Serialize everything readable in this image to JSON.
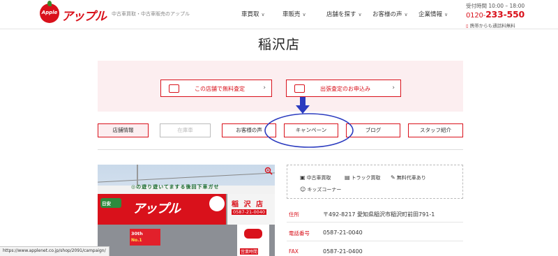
{
  "header": {
    "logo_mark": "Apple",
    "logo_text": "アップル",
    "tagline": "中古車買取・中古車販売のアップル",
    "nav": [
      {
        "label": "車買取"
      },
      {
        "label": "車販売"
      },
      {
        "label": "店舗を探す"
      },
      {
        "label": "お客様の声"
      },
      {
        "label": "企業情報"
      }
    ],
    "contact": {
      "hours": "受付時間 10:00 – 18:00",
      "phone_prefix": "0120-",
      "phone_number": "233-550",
      "mobile_note": "携帯からも通話料無料"
    }
  },
  "page": {
    "title": "稲沢店"
  },
  "cta": {
    "free_appraisal": "この店舗で無料査定",
    "visit_appraisal": "出張査定のお申込み"
  },
  "tabs": [
    {
      "label": "店舗情報",
      "state": "active"
    },
    {
      "label": "在庫車",
      "state": "disabled"
    },
    {
      "label": "お客様の声",
      "state": "normal"
    },
    {
      "label": "キャンペーン",
      "state": "normal"
    },
    {
      "label": "ブログ",
      "state": "normal"
    },
    {
      "label": "スタッフ紹介",
      "state": "normal"
    }
  ],
  "photo": {
    "caption": "◎の遊り遊いてまする後回下車ガせ",
    "sign_green": "日安",
    "brand": "アップル",
    "store_sign": "稲 沢 店",
    "store_tel": "0587-21-0040",
    "promo_top": "30th",
    "promo_bottom": "No.1",
    "post_sign": "営業時間"
  },
  "features": {
    "items": [
      {
        "icon": "car-buy-icon",
        "label": "中古車買取"
      },
      {
        "icon": "truck-icon",
        "label": "トラック買取"
      },
      {
        "icon": "free-inspection-icon",
        "label": "無料代車あり"
      },
      {
        "icon": "kids-corner-icon",
        "label": "キッズコーナー"
      }
    ]
  },
  "info": [
    {
      "label": "住所",
      "value": "〒492-8217 愛知県稲沢市稲沢町前田791-1"
    },
    {
      "label": "電話番号",
      "value": "0587-21-0040"
    },
    {
      "label": "FAX",
      "value": "0587-21-0400"
    }
  ],
  "status_bar": {
    "url": "https://www.applenet.co.jp/shop/2091/campaign/"
  },
  "colors": {
    "brand_red": "#d9111b",
    "banner_pink": "#fceef0",
    "annotation_blue": "#2b3bbf"
  }
}
